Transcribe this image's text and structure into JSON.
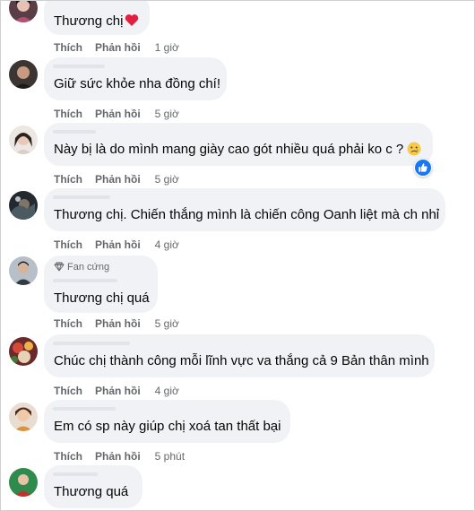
{
  "actions": {
    "like_label": "Thích",
    "reply_label": "Phản hồi"
  },
  "comments": [
    {
      "text": "Thương chị",
      "time": "1 giờ",
      "extra": "heart"
    },
    {
      "text": "Giữ sức khỏe nha đồng chí!",
      "time": "5 giờ"
    },
    {
      "text": "Này bị là do mình mang giày cao gót nhiều quá phải ko c ?",
      "time": "5 giờ",
      "extra": "crying-face",
      "reaction": "like"
    },
    {
      "text": "Thương chị. Chiến thắng mình là chiến công Oanh liệt mà ch nhỉ",
      "time": "4 giờ"
    },
    {
      "badge": "Fan cứng",
      "text": "Thương chị quá",
      "time": "5 giờ"
    },
    {
      "text": "Chúc chị thành công mỗi lĩnh vực va thắng cả 9 Bản thân mình",
      "time": "4 giờ"
    },
    {
      "text": "Em có sp này giúp chị xoá tan thất bại",
      "time": "5 phút"
    },
    {
      "text": "Thương quá"
    }
  ],
  "colors": {
    "bubble": "#f0f2f5",
    "action_text": "#65676b",
    "like_blue": "#1877f2",
    "heart_red": "#e41e3f"
  },
  "icons": [
    "heart-icon",
    "crying-face-icon",
    "like-reaction-icon",
    "diamond-icon"
  ]
}
